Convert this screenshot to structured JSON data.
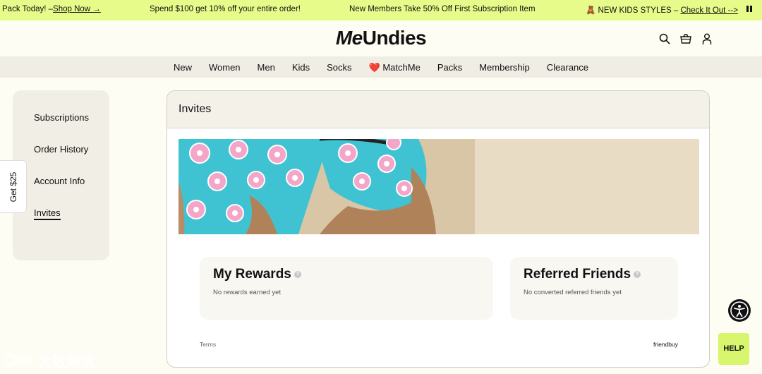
{
  "promo": {
    "msg1_prefix": "Pack Today! –",
    "msg1_link": "Shop Now →",
    "msg2": "Spend $100 get 10% off your entire order!",
    "msg3": "New Members Take 50% Off First Subscription Item",
    "msg4_prefix": "🧸 NEW KIDS STYLES – ",
    "msg4_link": "Check It Out -->",
    "bg": "#e6fb8a"
  },
  "header": {
    "logo_a": "Me",
    "logo_b": "Undies",
    "icons": [
      "search-icon",
      "cart-icon",
      "account-icon"
    ]
  },
  "nav": {
    "items": [
      "New",
      "Women",
      "Men",
      "Kids",
      "Socks",
      "❤️ MatchMe",
      "Packs",
      "Membership",
      "Clearance"
    ]
  },
  "sidebar": {
    "items": [
      "Subscriptions",
      "Order History",
      "Account Info",
      "Invites"
    ],
    "active": "Invites"
  },
  "referral_tab": {
    "label": "Get $25"
  },
  "invites": {
    "title": "Invites",
    "rewards": {
      "title": "My Rewards",
      "info": "?",
      "text": "No rewards earned yet"
    },
    "friends": {
      "title": "Referred Friends",
      "info": "?",
      "text": "No converted referred friends yet"
    },
    "terms": "Terms",
    "powered_by": "friendbuy"
  },
  "help": {
    "label": "HELP",
    "bg": "#d8f56e"
  },
  "watermark": {
    "text": "大数跨境"
  }
}
